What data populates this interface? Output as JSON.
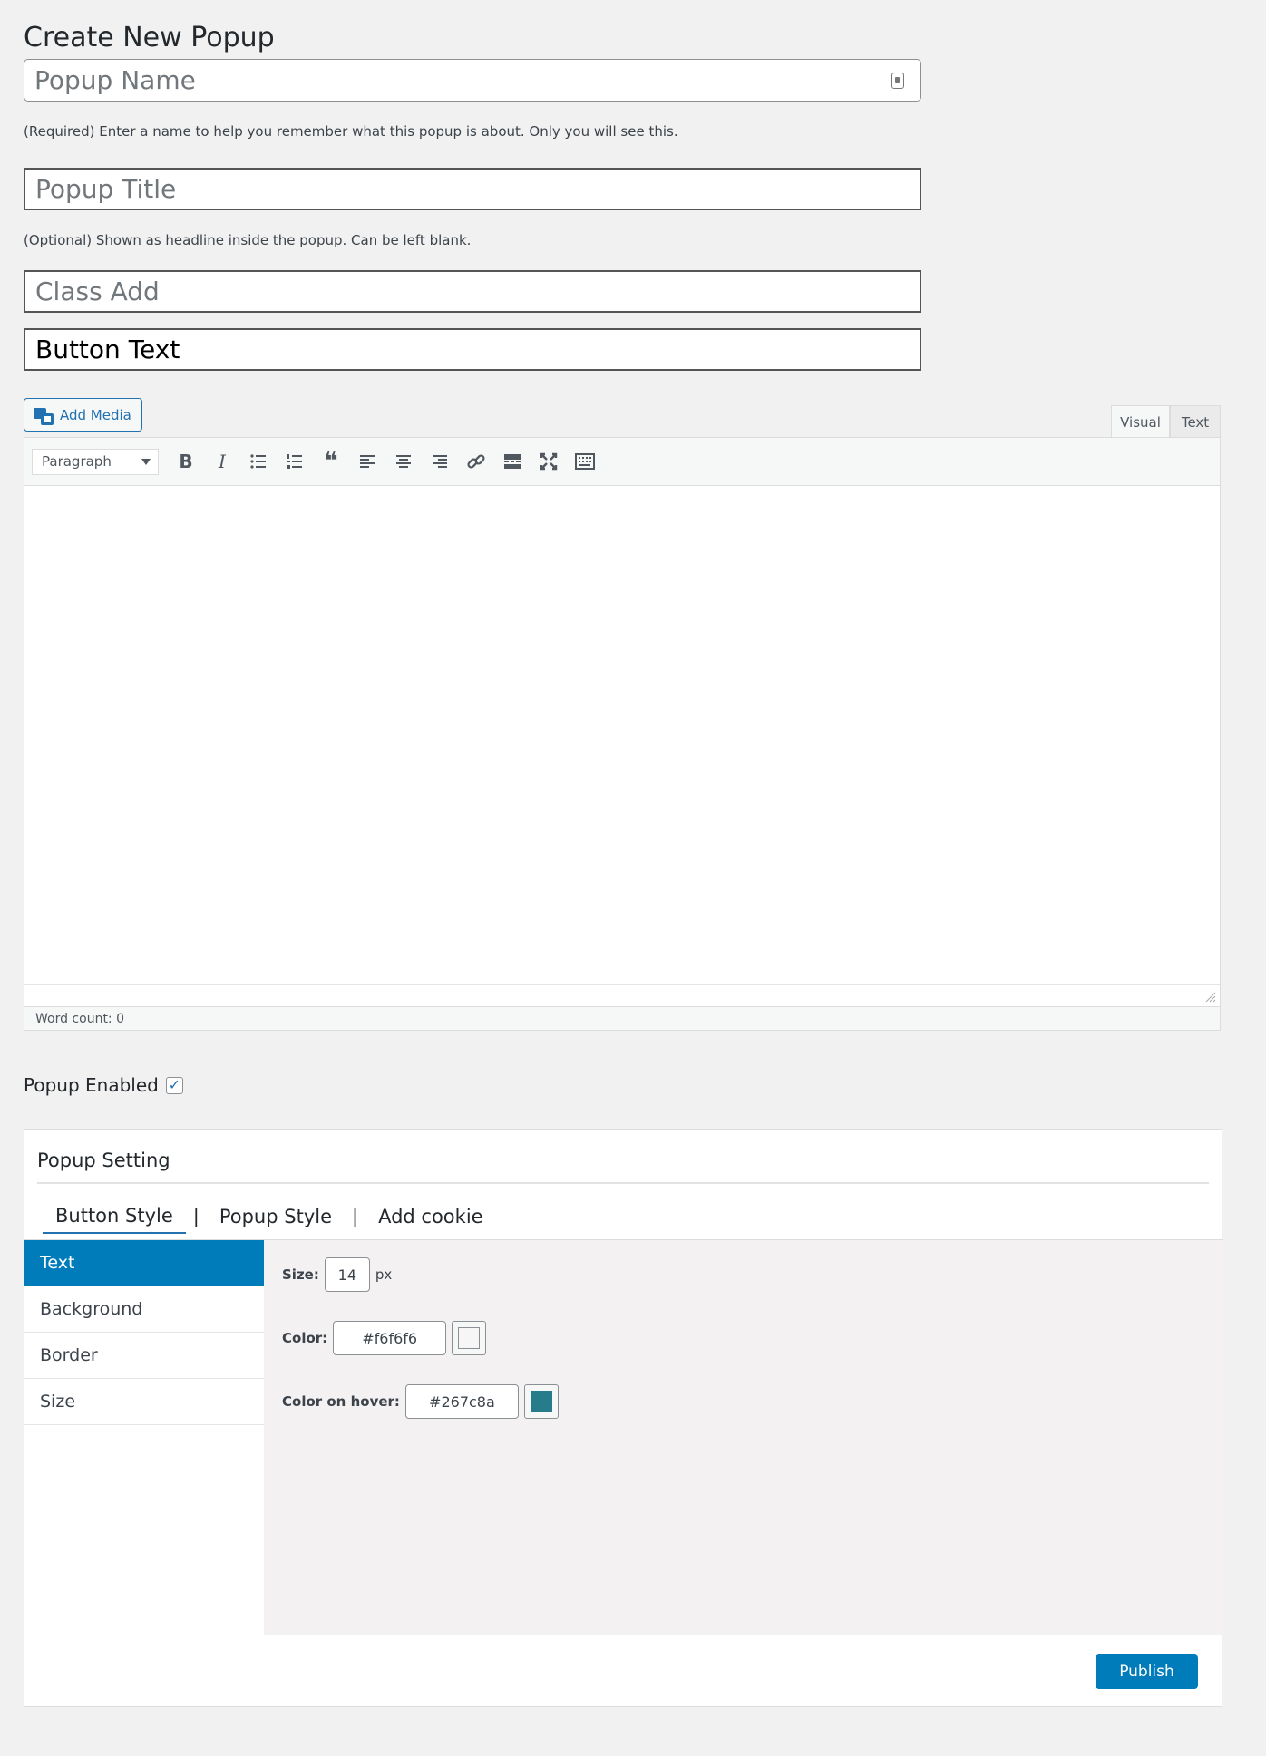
{
  "page": {
    "title": "Create New Popup"
  },
  "fields": {
    "popup_name_placeholder": "Popup Name",
    "popup_name_help": "(Required) Enter a name to help you remember what this popup is about. Only you will see this.",
    "popup_title_placeholder": "Popup Title",
    "popup_title_help": "(Optional) Shown as headline inside the popup. Can be left blank.",
    "class_add_placeholder": "Class Add",
    "button_text_value": "Button Text"
  },
  "editor": {
    "add_media_label": "Add Media",
    "tab_visual": "Visual",
    "tab_text": "Text",
    "format_select": "Paragraph",
    "word_count": "Word count: 0",
    "toolbar_icons": [
      "bold-icon",
      "italic-icon",
      "bullet-list-icon",
      "numbered-list-icon",
      "blockquote-icon",
      "align-left-icon",
      "align-center-icon",
      "align-right-icon",
      "link-icon",
      "read-more-icon",
      "fullscreen-icon",
      "toolbar-toggle-icon"
    ]
  },
  "enabled": {
    "label": "Popup Enabled",
    "checked": true,
    "check_glyph": "✓"
  },
  "settings": {
    "title": "Popup Setting",
    "tabs": [
      {
        "label": "Button Style"
      },
      {
        "label": "Popup Style"
      },
      {
        "label": "Add cookie"
      }
    ],
    "separator": "|",
    "side_nav": [
      {
        "label": "Text"
      },
      {
        "label": "Background"
      },
      {
        "label": "Border"
      },
      {
        "label": "Size"
      }
    ],
    "size": {
      "label": "Size:",
      "value": "14",
      "unit": "px"
    },
    "color": {
      "label": "Color:",
      "value": "#f6f6f6"
    },
    "color_hover": {
      "label": "Color on hover:",
      "value": "#267c8a"
    },
    "publish_label": "Publish"
  },
  "colors": {
    "accent": "#007cba",
    "swatch_color": "#f6f6f6",
    "swatch_hover": "#267c8a"
  }
}
